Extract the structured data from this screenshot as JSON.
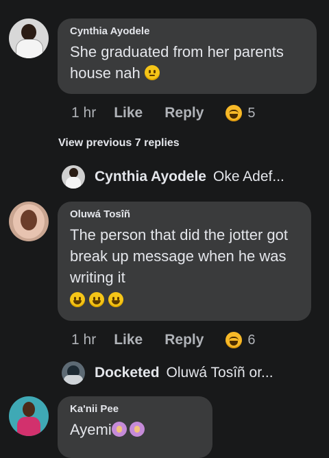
{
  "comments": [
    {
      "author": "Cynthia Ayodele",
      "text": "She graduated from her parents house nah",
      "emoji": "face-with-rolling-eyes",
      "time": "1 hr",
      "like_label": "Like",
      "reply_label": "Reply",
      "reaction": "laughing-reaction-icon",
      "reaction_count": "5"
    },
    {
      "author": "Oluwá Tosîñ",
      "text": "The person that did the jotter got break up message when he was writing it",
      "emojis": [
        "grinning-face",
        "grinning-face",
        "grinning-face"
      ],
      "time": "1 hr",
      "like_label": "Like",
      "reply_label": "Reply",
      "reaction": "laughing-reaction-icon",
      "reaction_count": "6"
    },
    {
      "author": "Ka'nii Pee",
      "text": "Ayemi",
      "emojis": [
        "person-gesturing-ok",
        "person-gesturing-ok"
      ]
    }
  ],
  "view_previous": "View previous 7 replies",
  "replies": [
    {
      "author": "Cynthia Ayodele",
      "preview": "Oke Adef..."
    },
    {
      "author": "Docketed",
      "preview": "Oluwá Tosîñ or..."
    }
  ],
  "colors": {
    "background": "#18191a",
    "bubble": "#3a3b3c",
    "text": "#e4e6eb",
    "secondary_text": "#b0b3b8",
    "reaction": "#f7b928"
  }
}
